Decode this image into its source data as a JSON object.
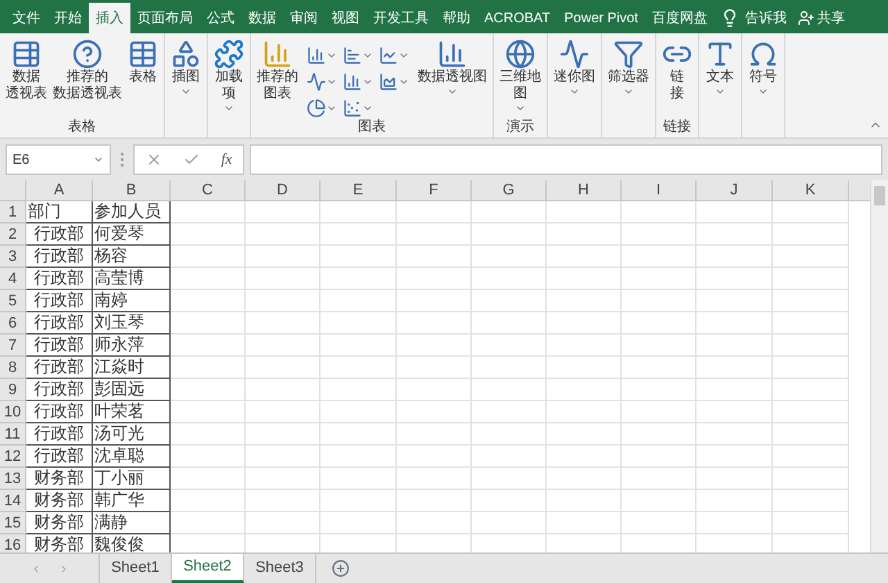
{
  "menu_tabs": [
    {
      "label": "文件",
      "selected": false
    },
    {
      "label": "开始",
      "selected": false
    },
    {
      "label": "插入",
      "selected": true
    },
    {
      "label": "页面布局",
      "selected": false
    },
    {
      "label": "公式",
      "selected": false
    },
    {
      "label": "数据",
      "selected": false
    },
    {
      "label": "审阅",
      "selected": false
    },
    {
      "label": "视图",
      "selected": false
    },
    {
      "label": "开发工具",
      "selected": false
    },
    {
      "label": "帮助",
      "selected": false
    },
    {
      "label": "ACROBAT",
      "selected": false
    },
    {
      "label": "Power Pivot",
      "selected": false
    },
    {
      "label": "百度网盘",
      "selected": false
    }
  ],
  "tell_me": "告诉我",
  "share": "共享",
  "ribbon_groups": [
    {
      "label": "表格",
      "buttons": [
        {
          "kind": "pivot",
          "lines": [
            "数据",
            "透视表"
          ],
          "menu": false
        },
        {
          "kind": "recpivot",
          "lines": [
            "推荐的",
            "数据透视表"
          ],
          "menu": false
        },
        {
          "kind": "table",
          "lines": [
            "表格"
          ],
          "menu": false
        }
      ]
    },
    {
      "buttons": [
        {
          "kind": "shapes",
          "lines": [
            "插图"
          ],
          "menu": true
        }
      ]
    },
    {
      "buttons": [
        {
          "kind": "addin",
          "lines": [
            "加载",
            "项"
          ],
          "menu": true
        }
      ]
    },
    {
      "label": "图表",
      "buttons": [
        {
          "kind": "recchart",
          "lines": [
            "推荐的",
            "图表"
          ],
          "menu": false
        },
        {
          "kind": "chartgrid"
        },
        {
          "kind": "pivotchart",
          "lines": [
            "数据透视图"
          ],
          "menu": true
        }
      ]
    },
    {
      "label": "演示",
      "buttons": [
        {
          "kind": "map",
          "lines": [
            "三维地",
            "图"
          ],
          "menu": true
        }
      ]
    },
    {
      "buttons": [
        {
          "kind": "sparkline",
          "lines": [
            "迷你图"
          ],
          "menu": true
        }
      ]
    },
    {
      "buttons": [
        {
          "kind": "filter",
          "lines": [
            "筛选器"
          ],
          "menu": true
        }
      ]
    },
    {
      "label": "链接",
      "buttons": [
        {
          "kind": "link",
          "lines": [
            "链",
            "接"
          ],
          "menu": false
        }
      ]
    },
    {
      "buttons": [
        {
          "kind": "text",
          "lines": [
            "文本"
          ],
          "menu": true
        }
      ]
    },
    {
      "buttons": [
        {
          "kind": "symbol",
          "lines": [
            "符号"
          ],
          "menu": true
        }
      ]
    }
  ],
  "name_box": "E6",
  "fx_label": "fx",
  "columns": [
    "A",
    "B",
    "C",
    "D",
    "E",
    "F",
    "G",
    "H",
    "I",
    "J",
    "K"
  ],
  "rows": [
    {
      "num": "1",
      "a": "部门",
      "b": "参加人员",
      "header": true
    },
    {
      "num": "2",
      "a": "行政部",
      "b": "何爱琴",
      "header": false
    },
    {
      "num": "3",
      "a": "行政部",
      "b": "杨容",
      "header": false
    },
    {
      "num": "4",
      "a": "行政部",
      "b": "高莹博",
      "header": false
    },
    {
      "num": "5",
      "a": "行政部",
      "b": "南婷",
      "header": false
    },
    {
      "num": "6",
      "a": "行政部",
      "b": "刘玉琴",
      "header": false
    },
    {
      "num": "7",
      "a": "行政部",
      "b": "师永萍",
      "header": false
    },
    {
      "num": "8",
      "a": "行政部",
      "b": "江焱时",
      "header": false
    },
    {
      "num": "9",
      "a": "行政部",
      "b": "彭固远",
      "header": false
    },
    {
      "num": "10",
      "a": "行政部",
      "b": "叶荣茗",
      "header": false
    },
    {
      "num": "11",
      "a": "行政部",
      "b": "汤可光",
      "header": false
    },
    {
      "num": "12",
      "a": "行政部",
      "b": "沈卓聪",
      "header": false
    },
    {
      "num": "13",
      "a": "财务部",
      "b": "丁小丽",
      "header": false
    },
    {
      "num": "14",
      "a": "财务部",
      "b": "韩广华",
      "header": false
    },
    {
      "num": "15",
      "a": "财务部",
      "b": "满静",
      "header": false
    },
    {
      "num": "16",
      "a": "财务部",
      "b": "魏俊俊",
      "header": false
    }
  ],
  "sheets": [
    {
      "label": "Sheet1",
      "selected": false
    },
    {
      "label": "Sheet2",
      "selected": true
    },
    {
      "label": "Sheet3",
      "selected": false
    }
  ]
}
